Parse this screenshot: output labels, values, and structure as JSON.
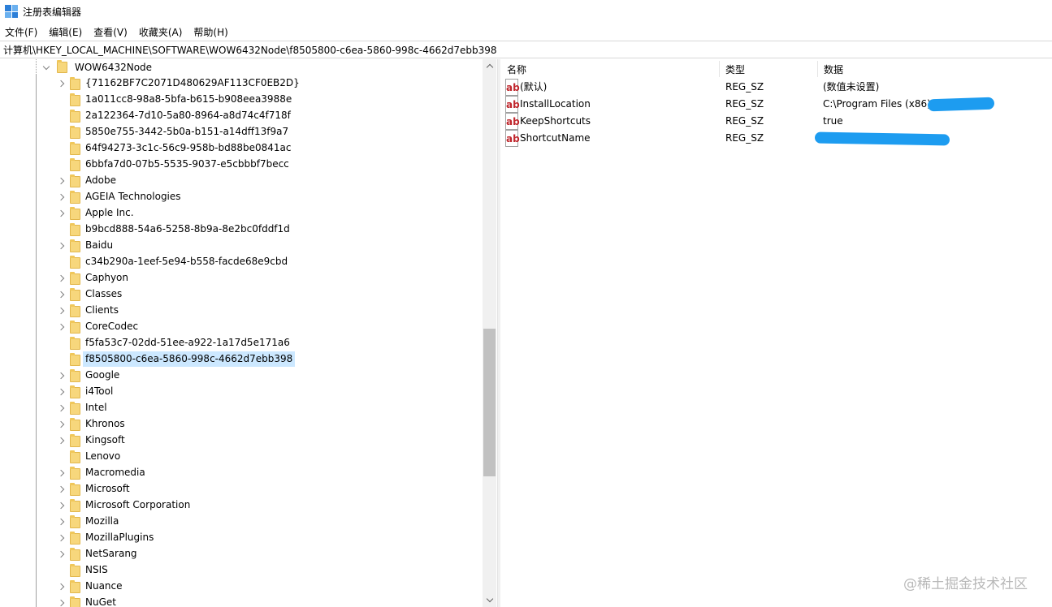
{
  "window": {
    "title": "注册表编辑器"
  },
  "menu": [
    "文件(F)",
    "编辑(E)",
    "查看(V)",
    "收藏夹(A)",
    "帮助(H)"
  ],
  "address": "计算机\\HKEY_LOCAL_MACHINE\\SOFTWARE\\WOW6432Node\\f8505800-c6ea-5860-998c-4662d7ebb398",
  "tree": {
    "parent": "WOW6432Node",
    "items": [
      {
        "label": "{71162BF7C2071D480629AF113CF0EB2D}",
        "expandable": true,
        "selected": false
      },
      {
        "label": "1a011cc8-98a8-5bfa-b615-b908eea3988e",
        "expandable": false,
        "selected": false
      },
      {
        "label": "2a122364-7d10-5a80-8964-a8d74c4f718f",
        "expandable": false,
        "selected": false
      },
      {
        "label": "5850e755-3442-5b0a-b151-a14dff13f9a7",
        "expandable": false,
        "selected": false
      },
      {
        "label": "64f94273-3c1c-56c9-958b-bd88be0841ac",
        "expandable": false,
        "selected": false
      },
      {
        "label": "6bbfa7d0-07b5-5535-9037-e5cbbbf7becc",
        "expandable": false,
        "selected": false
      },
      {
        "label": "Adobe",
        "expandable": true,
        "selected": false
      },
      {
        "label": "AGEIA Technologies",
        "expandable": true,
        "selected": false
      },
      {
        "label": "Apple Inc.",
        "expandable": true,
        "selected": false
      },
      {
        "label": "b9bcd888-54a6-5258-8b9a-8e2bc0fddf1d",
        "expandable": false,
        "selected": false
      },
      {
        "label": "Baidu",
        "expandable": true,
        "selected": false
      },
      {
        "label": "c34b290a-1eef-5e94-b558-facde68e9cbd",
        "expandable": false,
        "selected": false
      },
      {
        "label": "Caphyon",
        "expandable": true,
        "selected": false
      },
      {
        "label": "Classes",
        "expandable": true,
        "selected": false
      },
      {
        "label": "Clients",
        "expandable": true,
        "selected": false
      },
      {
        "label": "CoreCodec",
        "expandable": true,
        "selected": false
      },
      {
        "label": "f5fa53c7-02dd-51ee-a922-1a17d5e171a6",
        "expandable": false,
        "selected": false
      },
      {
        "label": "f8505800-c6ea-5860-998c-4662d7ebb398",
        "expandable": false,
        "selected": true
      },
      {
        "label": "Google",
        "expandable": true,
        "selected": false
      },
      {
        "label": "i4Tool",
        "expandable": true,
        "selected": false
      },
      {
        "label": "Intel",
        "expandable": true,
        "selected": false
      },
      {
        "label": "Khronos",
        "expandable": true,
        "selected": false
      },
      {
        "label": "Kingsoft",
        "expandable": true,
        "selected": false
      },
      {
        "label": "Lenovo",
        "expandable": false,
        "selected": false
      },
      {
        "label": "Macromedia",
        "expandable": true,
        "selected": false
      },
      {
        "label": "Microsoft",
        "expandable": true,
        "selected": false
      },
      {
        "label": "Microsoft Corporation",
        "expandable": true,
        "selected": false
      },
      {
        "label": "Mozilla",
        "expandable": true,
        "selected": false
      },
      {
        "label": "MozillaPlugins",
        "expandable": true,
        "selected": false
      },
      {
        "label": "NetSarang",
        "expandable": true,
        "selected": false
      },
      {
        "label": "NSIS",
        "expandable": false,
        "selected": false
      },
      {
        "label": "Nuance",
        "expandable": true,
        "selected": false
      },
      {
        "label": "NuGet",
        "expandable": true,
        "selected": false
      }
    ]
  },
  "values": {
    "headers": {
      "name": "名称",
      "type": "类型",
      "data": "数据"
    },
    "rows": [
      {
        "name": "(默认)",
        "type": "REG_SZ",
        "data": "(数值未设置)",
        "redacted": false
      },
      {
        "name": "InstallLocation",
        "type": "REG_SZ",
        "data": "C:\\Program Files (x86)\\",
        "redacted": true
      },
      {
        "name": "KeepShortcuts",
        "type": "REG_SZ",
        "data": "true",
        "redacted": false
      },
      {
        "name": "ShortcutName",
        "type": "REG_SZ",
        "data": "",
        "redacted": true
      }
    ],
    "icon": "ab-string-icon",
    "icon_text": "ab"
  },
  "watermark": "@稀土掘金技术社区",
  "colors": {
    "selection": "#cce8ff",
    "folder": "#f7d77c",
    "redaction": "#1d9cf0"
  }
}
